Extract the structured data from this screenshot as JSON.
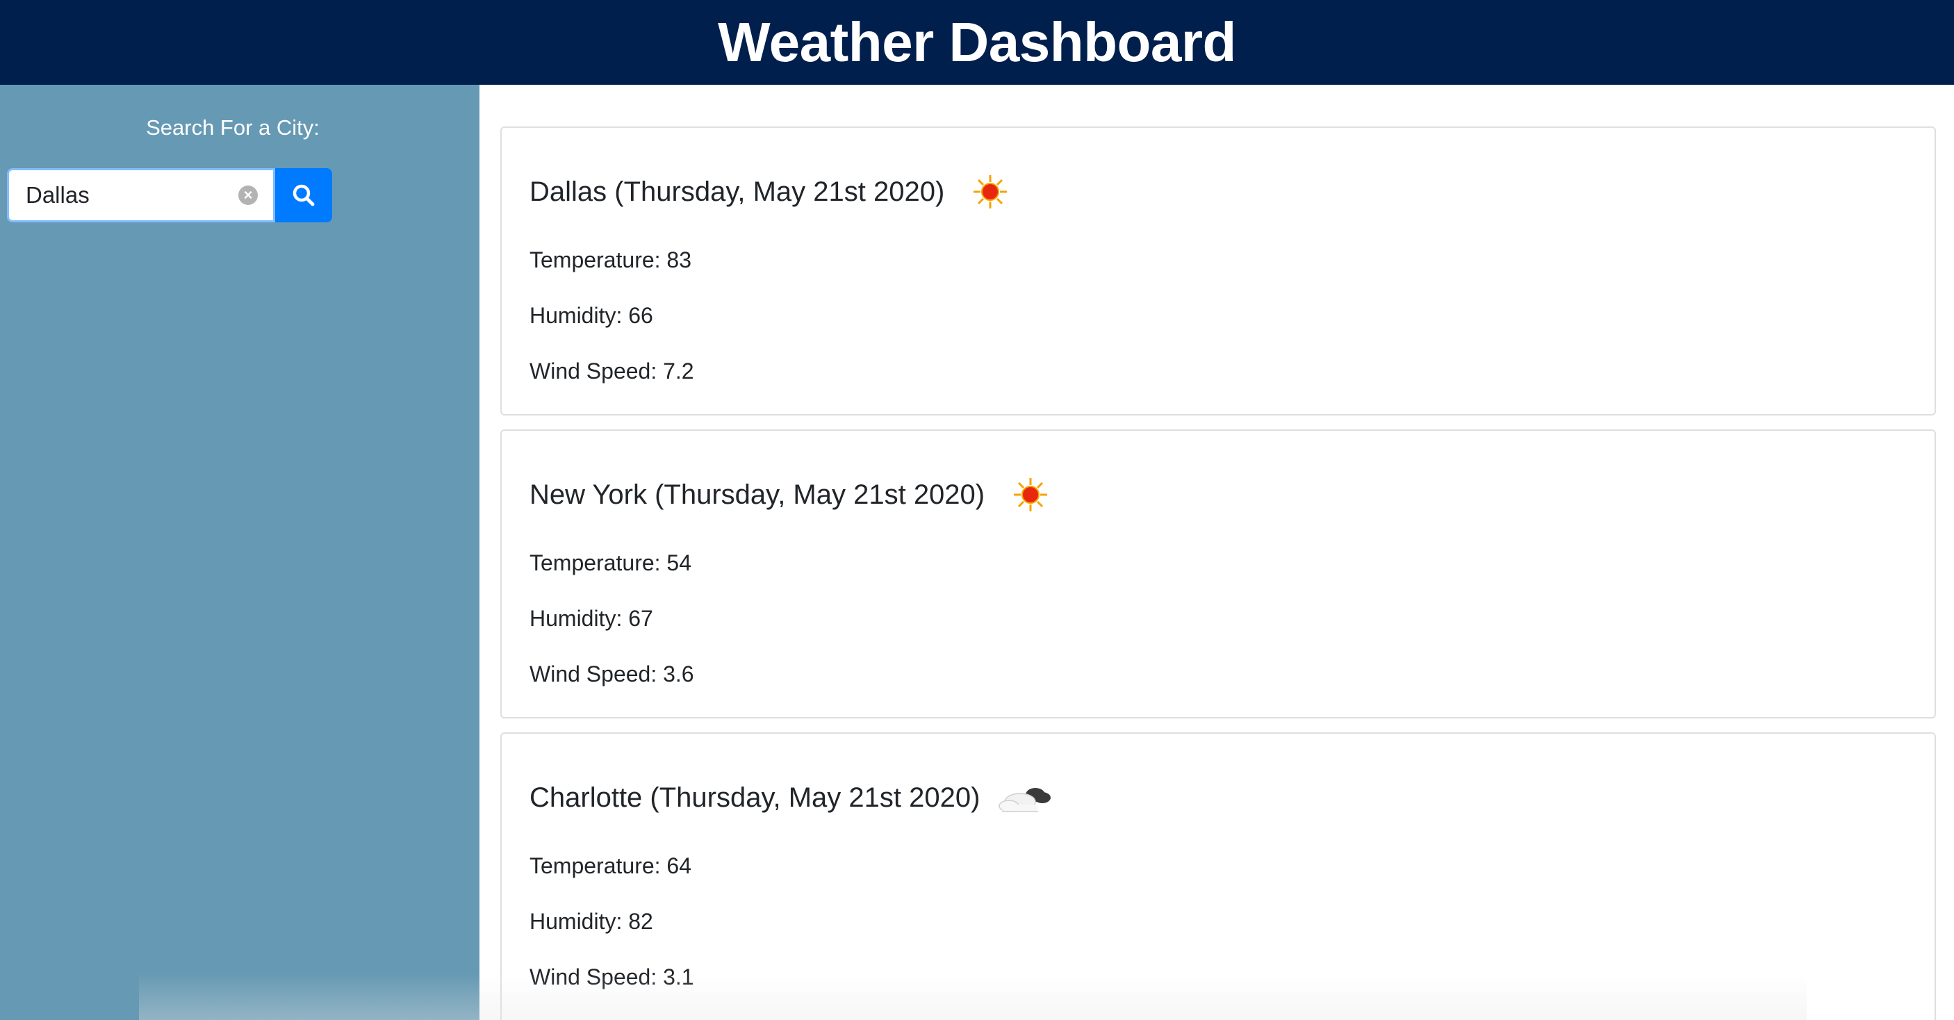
{
  "header": {
    "title": "Weather Dashboard"
  },
  "sidebar": {
    "search_label": "Search For a City:",
    "search_value": "Dallas",
    "search_button_icon": "search-icon",
    "clear_icon": "clear-icon"
  },
  "colors": {
    "header_bg": "#001f4d",
    "sidebar_bg": "#6699b3",
    "accent": "#007bff"
  },
  "cards": [
    {
      "title": "Dallas (Thursday, May 21st 2020)",
      "icon": "sun-icon",
      "temperature": "Temperature: 83",
      "humidity": "Humidity: 66",
      "wind": "Wind Speed: 7.2"
    },
    {
      "title": "New York (Thursday, May 21st 2020)",
      "icon": "sun-icon",
      "temperature": "Temperature: 54",
      "humidity": "Humidity: 67",
      "wind": "Wind Speed: 3.6"
    },
    {
      "title": "Charlotte (Thursday, May 21st 2020)",
      "icon": "cloud-icon",
      "temperature": "Temperature: 64",
      "humidity": "Humidity: 82",
      "wind": "Wind Speed: 3.1"
    }
  ]
}
